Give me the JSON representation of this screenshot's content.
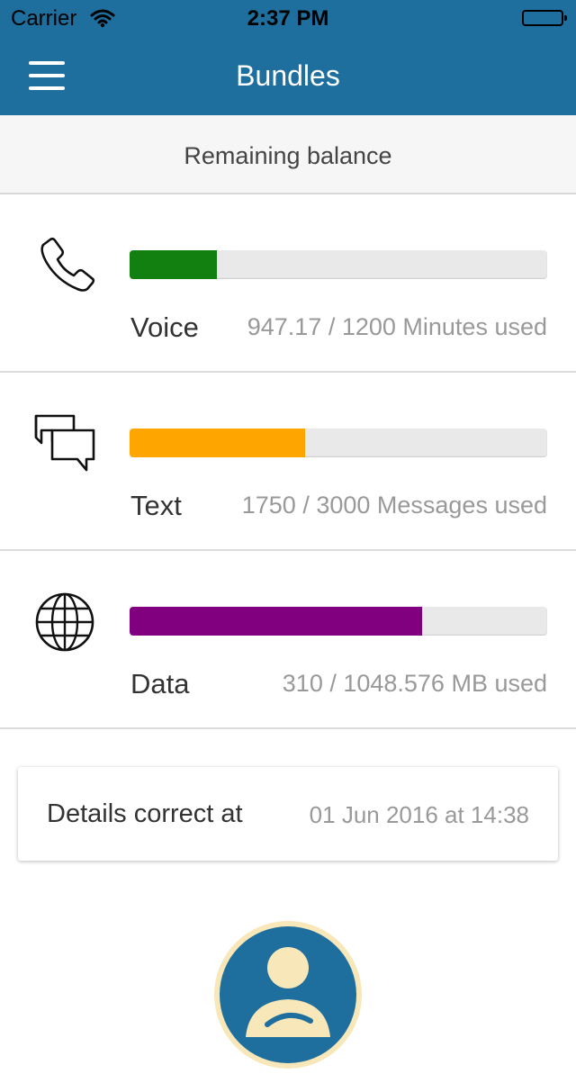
{
  "status_bar": {
    "carrier": "Carrier",
    "time": "2:37 PM"
  },
  "navbar": {
    "title": "Bundles",
    "menu_icon": "hamburger-menu-icon"
  },
  "section_header": "Remaining balance",
  "colors": {
    "navbar": "#1e6e9e",
    "voice": "#118011",
    "text": "#ffa500",
    "data": "#800080",
    "avatar_bg": "#1e6e9e",
    "avatar_accent": "#f8e7b9"
  },
  "bundles": [
    {
      "name": "Voice",
      "icon": "phone-icon",
      "usage": "947.17 / 1200 Minutes used",
      "bar_fraction": 0.21
    },
    {
      "name": "Text",
      "icon": "chat-bubbles-icon",
      "usage": "1750 / 3000 Messages used",
      "bar_fraction": 0.42
    },
    {
      "name": "Data",
      "icon": "globe-icon",
      "usage": "310 / 1048.576 MB used",
      "bar_fraction": 0.7
    }
  ],
  "details": {
    "label": "Details correct at",
    "value": "01 Jun 2016 at 14:38"
  },
  "avatar_icon": "user-avatar-icon"
}
